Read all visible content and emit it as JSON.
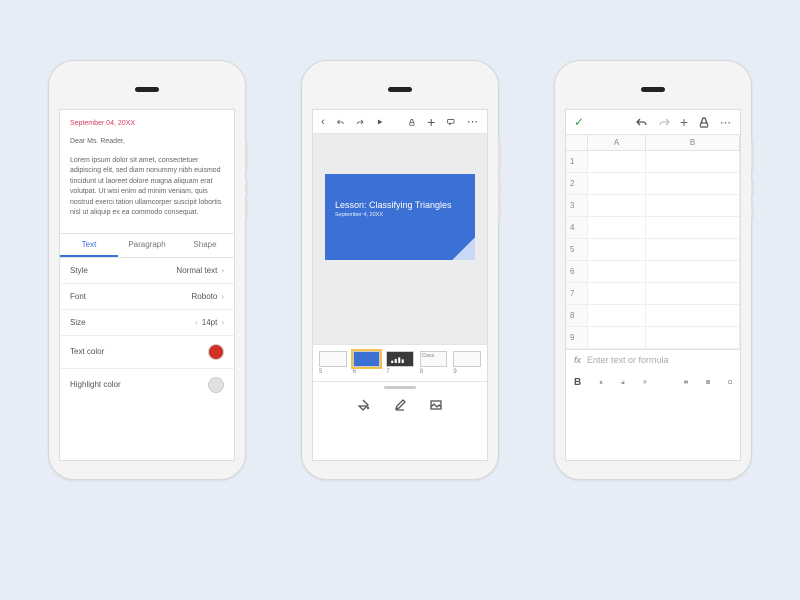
{
  "docs": {
    "date": "September 04, 20XX",
    "greeting": "Dear Ms. Reader,",
    "body": "Lorem ipsum dolor sit amet, consectetuer adipiscing elit, sed diam nonummy nibh euismod tincidunt ut laoreet dolore magna aliquam erat volutpat. Ut wisi enim ad minim veniam, quis nostrud exerci tation ullamcorper suscipit lobortis nisl ut aliquip ex ea commodo consequat.",
    "tabs": {
      "text": "Text",
      "paragraph": "Paragraph",
      "shape": "Shape"
    },
    "rows": {
      "style_label": "Style",
      "style_value": "Normal text",
      "font_label": "Font",
      "font_value": "Roboto",
      "size_label": "Size",
      "size_value": "14pt",
      "textcolor_label": "Text color",
      "textcolor_value": "#d3322a",
      "highlight_label": "Highlight color",
      "highlight_value": "#e0e0e0"
    }
  },
  "slides": {
    "title": "Lesson: Classifying Triangles",
    "subtitle": "September 4, 20XX",
    "thumbs": [
      "5",
      "6",
      "7",
      "8",
      "9"
    ],
    "thumb_labels": {
      "8": "Class"
    }
  },
  "sheets": {
    "columns": [
      "A",
      "B"
    ],
    "row_count": 9,
    "fx_placeholder": "Enter text or formula",
    "bold": "B"
  }
}
